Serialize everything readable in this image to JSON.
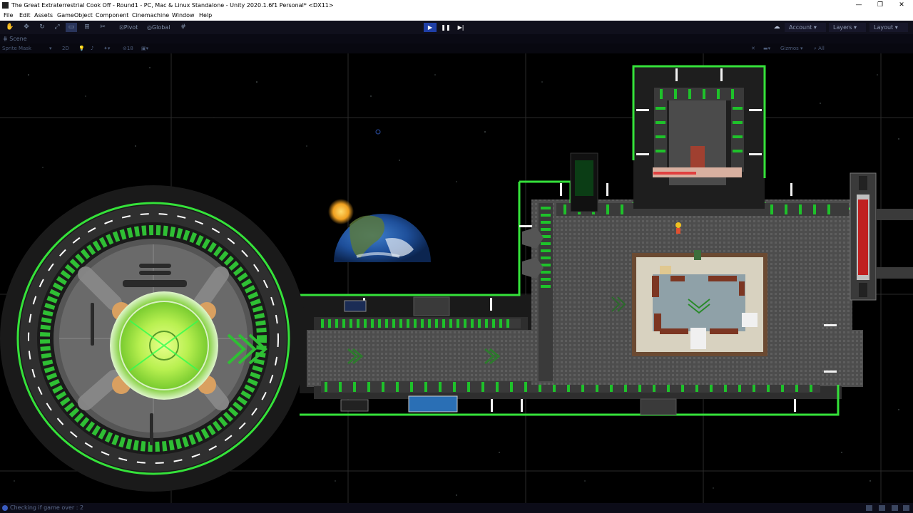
{
  "window": {
    "title": "The Great Extraterrestrial Cook Off - Round1 - PC, Mac & Linux Standalone - Unity 2020.1.6f1 Personal* <DX11>",
    "controls": [
      "—",
      "❐",
      "✕"
    ]
  },
  "menu": [
    "File",
    "Edit",
    "Assets",
    "GameObject",
    "Component",
    "Cinemachine",
    "Window",
    "Help"
  ],
  "toolbar": {
    "tools": [
      "hand-tool",
      "move-tool",
      "rotate-tool",
      "scale-tool",
      "rect-tool",
      "transform-tool",
      "custom-tool"
    ],
    "pivot_label": "Pivot",
    "global_label": "Global",
    "account_label": "Account",
    "layers_label": "Layers",
    "layout_label": "Layout"
  },
  "scene_tab": {
    "label": "Scene"
  },
  "scene_toolbar": {
    "draw_mode": "Sprite Mask",
    "mode_2d": "2D",
    "layer_count": "18",
    "gizmos_label": "Gizmos",
    "search_placeholder": "All"
  },
  "status": {
    "message": "Checking if game over : 2"
  },
  "colors": {
    "neon_green": "#35e23a",
    "floor": "#4f4f4f",
    "space": "#000000",
    "accent_blue": "#1f3fa6"
  }
}
